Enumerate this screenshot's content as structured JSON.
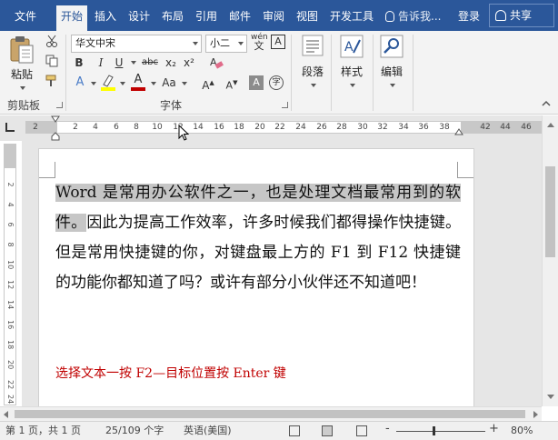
{
  "tabs": [
    {
      "label": "文件",
      "active": false
    },
    {
      "label": "开始",
      "active": true
    },
    {
      "label": "插入",
      "active": false
    },
    {
      "label": "设计",
      "active": false
    },
    {
      "label": "布局",
      "active": false
    },
    {
      "label": "引用",
      "active": false
    },
    {
      "label": "邮件",
      "active": false
    },
    {
      "label": "审阅",
      "active": false
    },
    {
      "label": "视图",
      "active": false
    },
    {
      "label": "开发工具",
      "active": false
    }
  ],
  "tell_me": "告诉我...",
  "login": "登录",
  "share": "共享",
  "ribbon": {
    "clipboard": {
      "paste": "粘贴",
      "label": "剪贴板"
    },
    "font": {
      "font_name": "华文中宋",
      "font_size": "小二",
      "wen_label": "wén",
      "wen_char": "文",
      "boxed_a": "A",
      "bold": "B",
      "italic": "I",
      "underline": "U",
      "strike": "abc",
      "subscript": "x₂",
      "superscript": "x²",
      "text_effects": "A",
      "font_color": "A",
      "change_case": "Aa",
      "grow": "A",
      "shrink": "A",
      "shade_char": "A",
      "enclose_char": "字",
      "label": "字体"
    },
    "paragraph": {
      "label": "段落"
    },
    "styles": {
      "label": "样式"
    },
    "editing": {
      "label": "编辑"
    }
  },
  "ruler_ticks": [
    "2",
    "2",
    "4",
    "6",
    "8",
    "10",
    "12",
    "14",
    "16",
    "18",
    "20",
    "22",
    "24",
    "26",
    "28",
    "30",
    "32",
    "34",
    "36",
    "38",
    "42",
    "44",
    "46"
  ],
  "vruler_ticks": [
    "2",
    "4",
    "6",
    "8",
    "10",
    "12",
    "14",
    "16",
    "18",
    "20",
    "22",
    "24",
    "26"
  ],
  "document": {
    "selected_text": "Word 是常用办公软件之一，也是处理文档最常用到的软件。",
    "rest_text": "因此为提高工作效率，许多时候我们都得操作快捷键。但是常用快捷键的你，对键盘最上方的 F1 到 F12 快捷键的功能你都知道了吗？或许有部分小伙伴还不知道吧！",
    "hint": "选择文本一按 F2—目标位置按 Enter 键"
  },
  "status": {
    "page": "第 1 页，共 1 页",
    "words": "25/109 个字",
    "language": "英语(美国)",
    "zoom_minus": "-",
    "zoom_plus": "+",
    "zoom": "80%"
  },
  "colors": {
    "brand": "#2b579a",
    "hint_red": "#c00000",
    "highlight_yellow": "#ffff00",
    "font_color_red": "#c00000"
  }
}
